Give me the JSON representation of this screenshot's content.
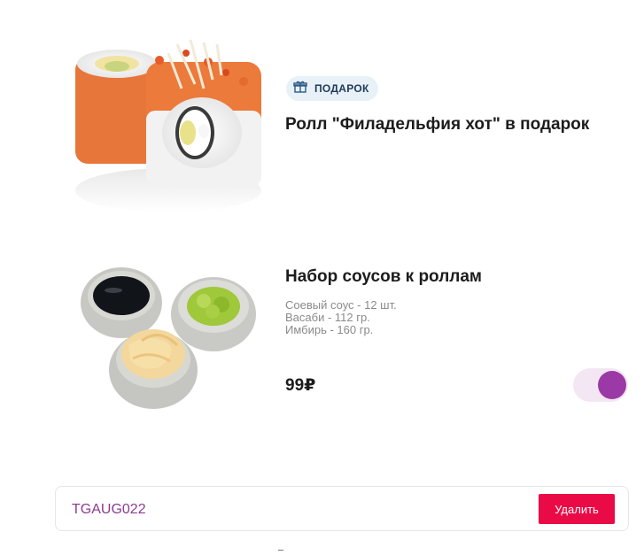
{
  "gift_item": {
    "badge_label": "ПОДАРОК",
    "badge_icon": "gift-icon",
    "title": "Ролл \"Филадельфия хот\" в подарок",
    "image": "sushi-roll-image"
  },
  "sauce_item": {
    "title": "Набор соусов к роллам",
    "description": [
      "Соевый соус - 12 шт.",
      "Васаби - 112 гр.",
      "Имбирь - 160 гр."
    ],
    "price": "99₽",
    "toggle_on": true,
    "toggle_color": "#9b3aa6",
    "image": "sauces-image"
  },
  "promo": {
    "code": "TGAUG022",
    "remove_label": "Удалить",
    "remove_color": "#ea0a45"
  }
}
